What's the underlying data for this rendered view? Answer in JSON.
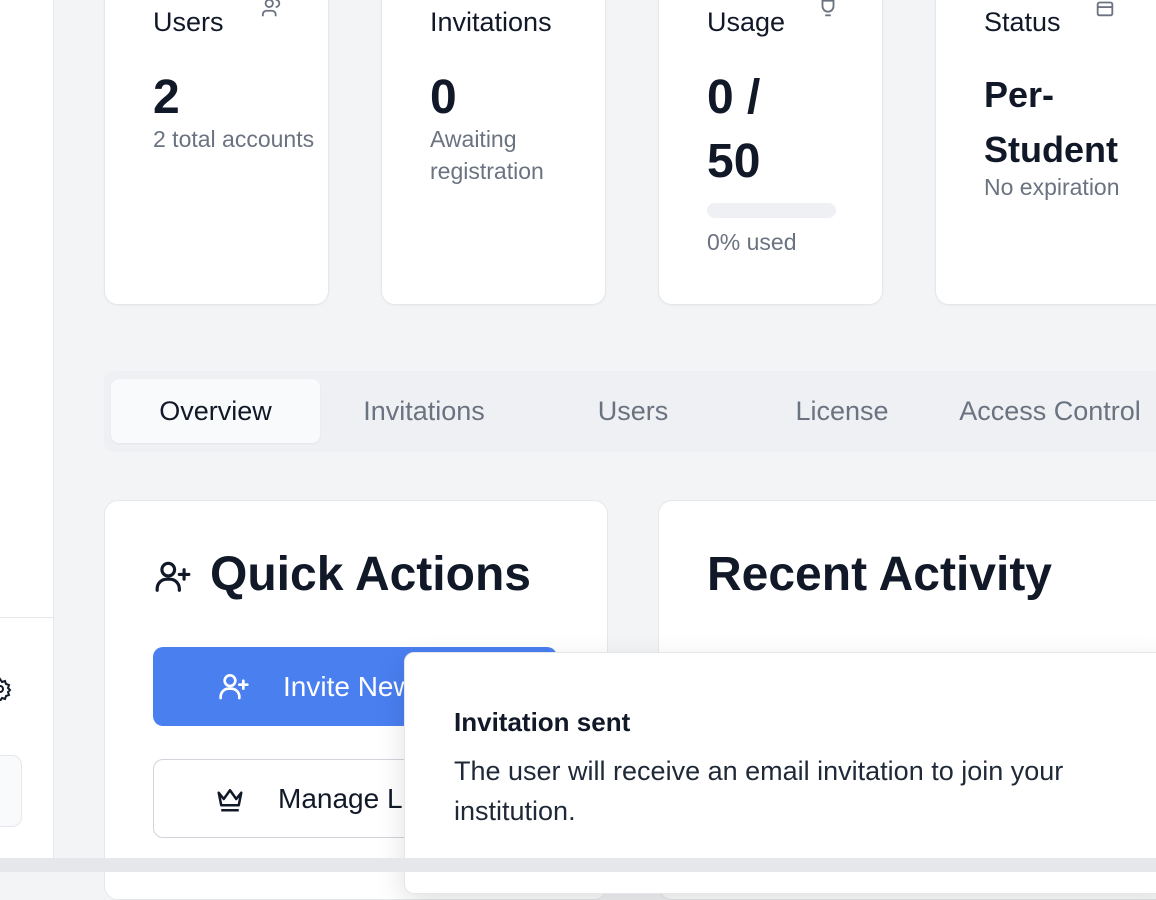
{
  "stats": [
    {
      "title": "Users",
      "value": "2",
      "sub": "2 total accounts",
      "icon": "users-icon"
    },
    {
      "title": "Invitations",
      "value": "0",
      "sub": "Awaiting registration",
      "icon": "mail-icon"
    },
    {
      "title": "Usage",
      "value_line1": "0 /",
      "value_line2": "50",
      "sub": "0% used",
      "progress_percent": 0,
      "icon": "trophy-icon"
    },
    {
      "title": "Status",
      "value_line1": "Per-",
      "value_line2": "Student",
      "sub": "No expiration",
      "icon": "calendar-icon"
    }
  ],
  "tabs": [
    {
      "label": "Overview",
      "active": true
    },
    {
      "label": "Invitations",
      "active": false
    },
    {
      "label": "Users",
      "active": false
    },
    {
      "label": "License",
      "active": false
    },
    {
      "label": "Access Control",
      "active": false
    }
  ],
  "quick_actions": {
    "title": "Quick Actions",
    "icon": "user-plus-icon",
    "invite_label": "Invite New User",
    "manage_label": "Manage License"
  },
  "recent_activity": {
    "title": "Recent Activity"
  },
  "toast": {
    "title": "Invitation sent",
    "description": "The user will receive an email invitation to join your institution."
  },
  "colors": {
    "accent": "#4a7ff0",
    "background": "#f3f4f6",
    "card": "#ffffff",
    "muted_text": "#6b7280"
  }
}
